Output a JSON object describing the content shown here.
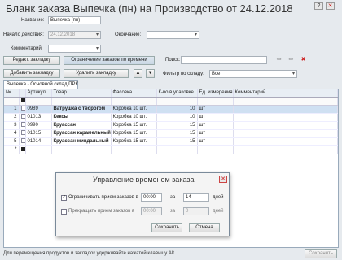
{
  "title": "Бланк заказа Выпечка (пн) на Производство от 24.12.2018",
  "window_buttons": {
    "help": "?",
    "close": "✕"
  },
  "form": {
    "name_label": "Название:",
    "name_value": "Выпечка (пн)",
    "start_label": "Начало действия:",
    "start_value": "24.12.2018",
    "end_label": "Окончание:",
    "end_value": "",
    "comment_label": "Комментарий:",
    "comment_value": ""
  },
  "toolbar": {
    "edit_tab": "Редакт. закладку",
    "limit_orders": "Ограничение заказов по времени",
    "search_label": "Поиск:",
    "search_value": "",
    "add_tab": "Добавить закладку",
    "delete_tab": "Удалить закладку",
    "up": "▲",
    "down": "▼",
    "back": "⇦",
    "forward": "⇨",
    "clear": "✖",
    "filter_label": "Фильтр по складу:",
    "filter_value": "Все"
  },
  "tab_label": "Выпечка - Основной склад ПРК",
  "table": {
    "headers": [
      "№",
      "",
      "Артикул",
      "Товар",
      "Фасовка",
      "К-во в упаковке",
      "Ед. измерения",
      "Комментарий"
    ],
    "rows": [
      {
        "n": "1",
        "article": "0989",
        "product": "Ватрушка с творогом",
        "pack": "Коробка 10 шт.",
        "qty": "10",
        "unit": "шт",
        "comment": ""
      },
      {
        "n": "2",
        "article": "01013",
        "product": "Кексы",
        "pack": "Коробка 10 шт.",
        "qty": "10",
        "unit": "шт",
        "comment": ""
      },
      {
        "n": "3",
        "article": "0990",
        "product": "Круассан",
        "pack": "Коробка 15 шт.",
        "qty": "15",
        "unit": "шт",
        "comment": ""
      },
      {
        "n": "4",
        "article": "01015",
        "product": "Круассан карамельный",
        "pack": "Коробка 15 шт.",
        "qty": "15",
        "unit": "шт",
        "comment": ""
      },
      {
        "n": "5",
        "article": "01014",
        "product": "Круассан миндальный",
        "pack": "Коробка 15 шт.",
        "qty": "15",
        "unit": "шт",
        "comment": ""
      }
    ],
    "new_row_marker": "*"
  },
  "dialog": {
    "title": "Управление временем заказа",
    "close": "✕",
    "limit_label": "Ограничивать прием заказов в",
    "limit_checked": true,
    "limit_time": "00:00",
    "limit_for": "за",
    "limit_days": "14",
    "limit_unit": "дней",
    "stop_label": "Прекращать прием заказов в",
    "stop_checked": false,
    "stop_time": "00:00",
    "stop_for": "за",
    "stop_days": "0",
    "stop_unit": "дней",
    "save": "Сохранить",
    "cancel": "Отмена"
  },
  "status_text": "Для перемещения продуктов и закладок удерживайте нажатой клавишу Alt",
  "save_button": "Сохранить",
  "colors": {
    "selected_row": "#cfe0f2",
    "header_bg": "#e8eef4",
    "window_bg": "#e6eaee",
    "accent_red": "#cc2222"
  }
}
